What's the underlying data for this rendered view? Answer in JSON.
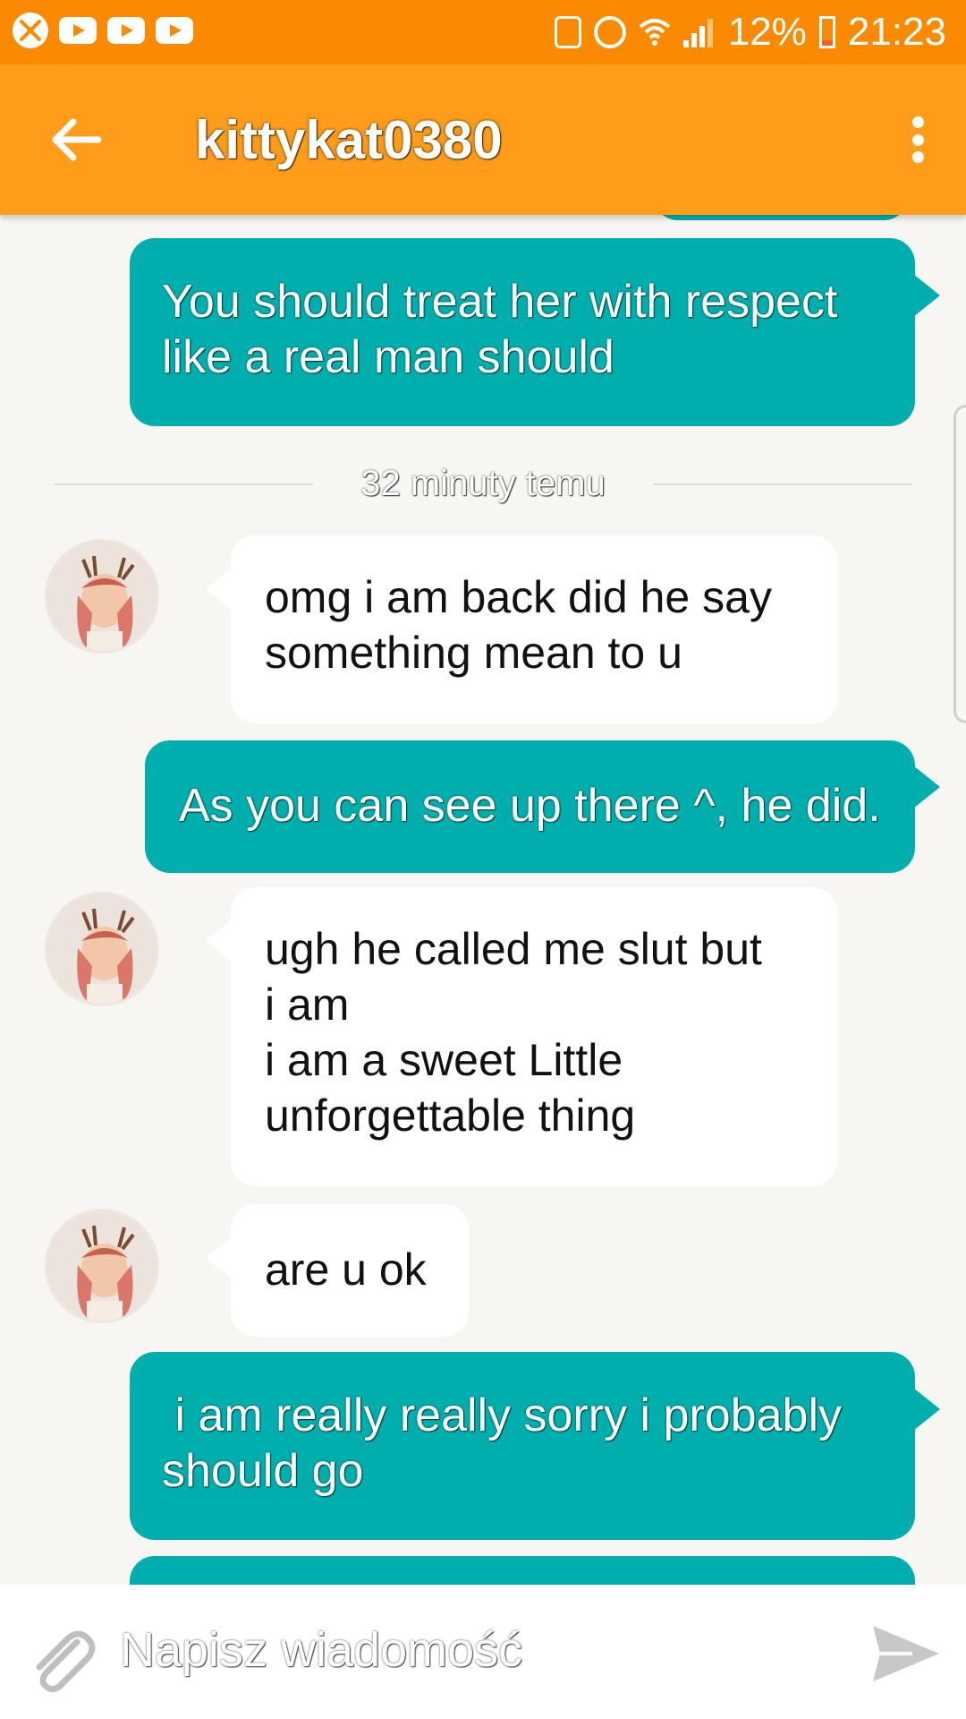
{
  "status_bar": {
    "battery": "12%",
    "time": "21:23",
    "left_icons": [
      "xbox-icon",
      "youtube-icon",
      "youtube-icon",
      "youtube-icon"
    ],
    "right_icons": [
      "battery-saver-icon",
      "alarm-icon",
      "wifi-icon",
      "signal-icon",
      "battery-icon"
    ]
  },
  "app_bar": {
    "title": "kittykat0380",
    "back_icon": "arrow-left-icon",
    "menu_icon": "more-vert-icon"
  },
  "messages": {
    "m1": "You should treat her with respect\nlike a real man should",
    "timestamp": "32 minuty temu",
    "m2": "omg i am back did he say\nsomething mean to u",
    "m3": "As you can see up there ^, he did.",
    "m4": "ugh he called me slut but\ni am\ni am a sweet Little\nunforgettable thing",
    "m5": "are u ok",
    "m6": " i am really really sorry i probably\nshould go"
  },
  "input_bar": {
    "placeholder": "Napisz wiadomość",
    "attach_icon": "paperclip-icon",
    "send_icon": "send-icon"
  },
  "colors": {
    "status_bar": "#fb8a00",
    "app_bar": "#ff9d1b",
    "outgoing_bubble": "#00aeae",
    "incoming_bubble": "#ffffff",
    "background": "#f7f6f2"
  }
}
